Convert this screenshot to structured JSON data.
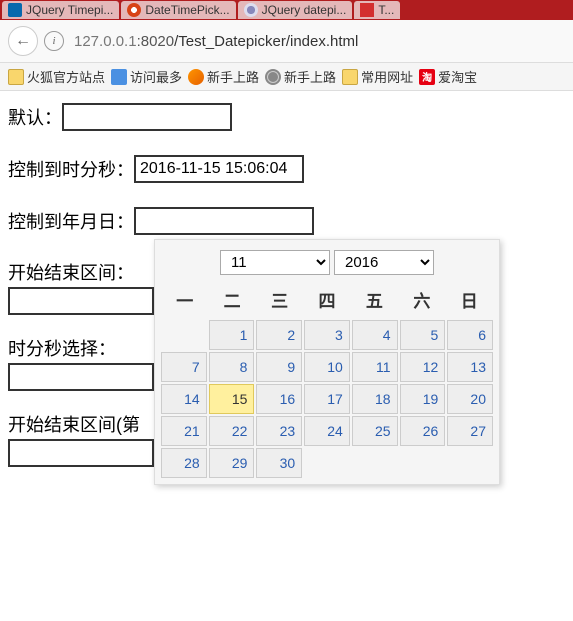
{
  "tabs": [
    {
      "icon": "jq",
      "label": "JQuery Timepi..."
    },
    {
      "icon": "clock",
      "label": "DateTimePick..."
    },
    {
      "icon": "flower",
      "label": "JQuery datepi..."
    },
    {
      "icon": "red",
      "label": "T..."
    }
  ],
  "nav": {
    "back_glyph": "←",
    "info_glyph": "i",
    "url_host": "127.0.0.1",
    "url_port": ":8020",
    "url_path": "/Test_Datepicker/index.html"
  },
  "bookmarks": [
    {
      "icon": "folder",
      "label": "火狐官方站点"
    },
    {
      "icon": "blue",
      "label": "访问最多"
    },
    {
      "icon": "ff",
      "label": "新手上路"
    },
    {
      "icon": "globe",
      "label": "新手上路"
    },
    {
      "icon": "folder",
      "label": "常用网址"
    },
    {
      "icon": "red",
      "icon_text": "淘",
      "label": "爱淘宝"
    }
  ],
  "form": {
    "default_label": "默认：",
    "default_value": "",
    "hms_label": "控制到时分秒：",
    "hms_value": "2016-11-15 15:06:04",
    "ymd_label": "控制到年月日：",
    "ymd_value": "",
    "range1_label": "开始结束区间：",
    "hms_select_label": "时分秒选择：",
    "range2_label": "开始结束区间(第"
  },
  "datepicker": {
    "month": "11",
    "year": "2016",
    "weekdays": [
      "一",
      "二",
      "三",
      "四",
      "五",
      "六",
      "日"
    ],
    "grid": [
      [
        "",
        "1",
        "2",
        "3",
        "4",
        "5",
        "6"
      ],
      [
        "7",
        "8",
        "9",
        "10",
        "11",
        "12",
        "13"
      ],
      [
        "14",
        "15",
        "16",
        "17",
        "18",
        "19",
        "20"
      ],
      [
        "21",
        "22",
        "23",
        "24",
        "25",
        "26",
        "27"
      ],
      [
        "28",
        "29",
        "30",
        "",
        "",
        "",
        ""
      ]
    ],
    "today": "15"
  }
}
